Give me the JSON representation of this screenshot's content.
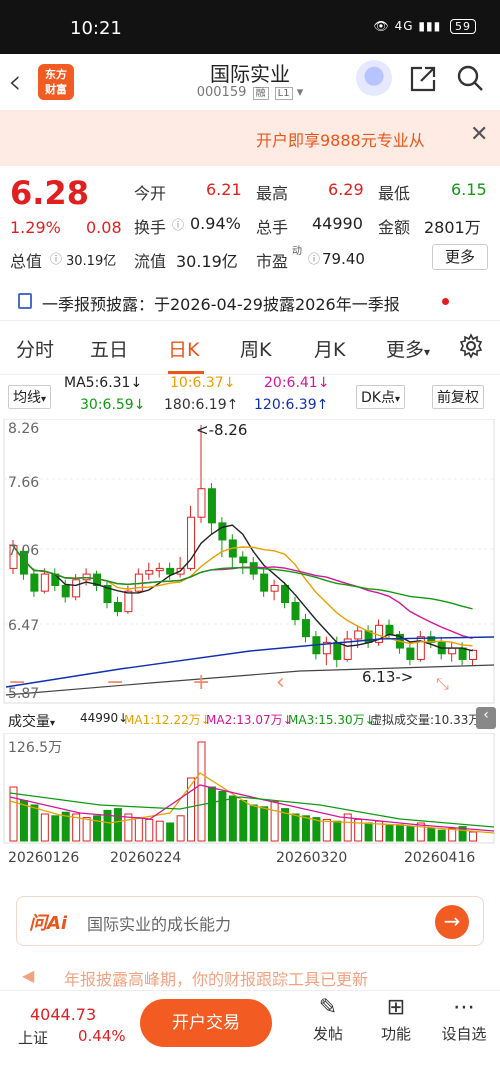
{
  "status": {
    "time": "10:21",
    "signal": "4G",
    "battery": "59"
  },
  "header": {
    "title": "国际实业",
    "code": "000159",
    "tag1": "融",
    "tag2": "L1",
    "logo_line1": "东方",
    "logo_line2": "财富"
  },
  "banner": {
    "text": "开户即享9888元专业从"
  },
  "quote": {
    "price": "6.28",
    "change_pct": "1.29%",
    "change": "0.08",
    "open_label": "今开",
    "open": "6.21",
    "high_label": "最高",
    "high": "6.29",
    "low_label": "最低",
    "low": "6.15",
    "turnover_label": "换手",
    "turnover": "0.94%",
    "volume_label": "总手",
    "volume": "44990",
    "amount_label": "金额",
    "amount": "2801万",
    "mktcap_label": "总值",
    "mktcap": "30.19亿",
    "float_label": "流值",
    "float_cap": "30.19亿",
    "pe_label": "市盈",
    "pe_sup": "动",
    "pe": "79.40",
    "more": "更多"
  },
  "notice": {
    "text": "一季报预披露：于2026-04-29披露2026年一季报"
  },
  "tabs": [
    "分时",
    "五日",
    "日K",
    "周K",
    "月K",
    "更多"
  ],
  "ma": {
    "select": "均线",
    "ma5": "MA5:6.31↓",
    "ma10": "10:6.37↓",
    "ma20": "20:6.41↓",
    "ma30": "30:6.59↓",
    "ma180": "180:6.19↑",
    "ma120": "120:6.39↑",
    "dk": "DK点",
    "fq": "前复权"
  },
  "kline": {
    "y_high": "8.26",
    "y2": "7.66",
    "y3": "7.06",
    "y4": "6.47",
    "y_low": "5.87",
    "max_label": "<-8.26",
    "min_label": "6.13->"
  },
  "volume": {
    "select": "成交量",
    "value": "44990↓",
    "ma1": "MA1:12.22万↓",
    "ma2": "MA2:13.07万↓",
    "ma3": "MA3:15.30万↓",
    "virtual": "虚拟成交量:10.33万",
    "scale": "126.5万"
  },
  "dates": [
    "20260126",
    "20260224",
    "20260320",
    "20260416"
  ],
  "ai": {
    "label": "问Ai",
    "text": "国际实业的成长能力"
  },
  "peek": {
    "text": "年报披露高峰期，你的财报跟踪工具已更新"
  },
  "bottom": {
    "index": "4044.73",
    "index_name": "上证",
    "index_pct": "0.44%",
    "trade": "开户交易",
    "post": "发帖",
    "func": "功能",
    "watch": "设自选"
  },
  "colors": {
    "up": "#e02020",
    "down": "#119911",
    "accent": "#e8561c"
  }
}
